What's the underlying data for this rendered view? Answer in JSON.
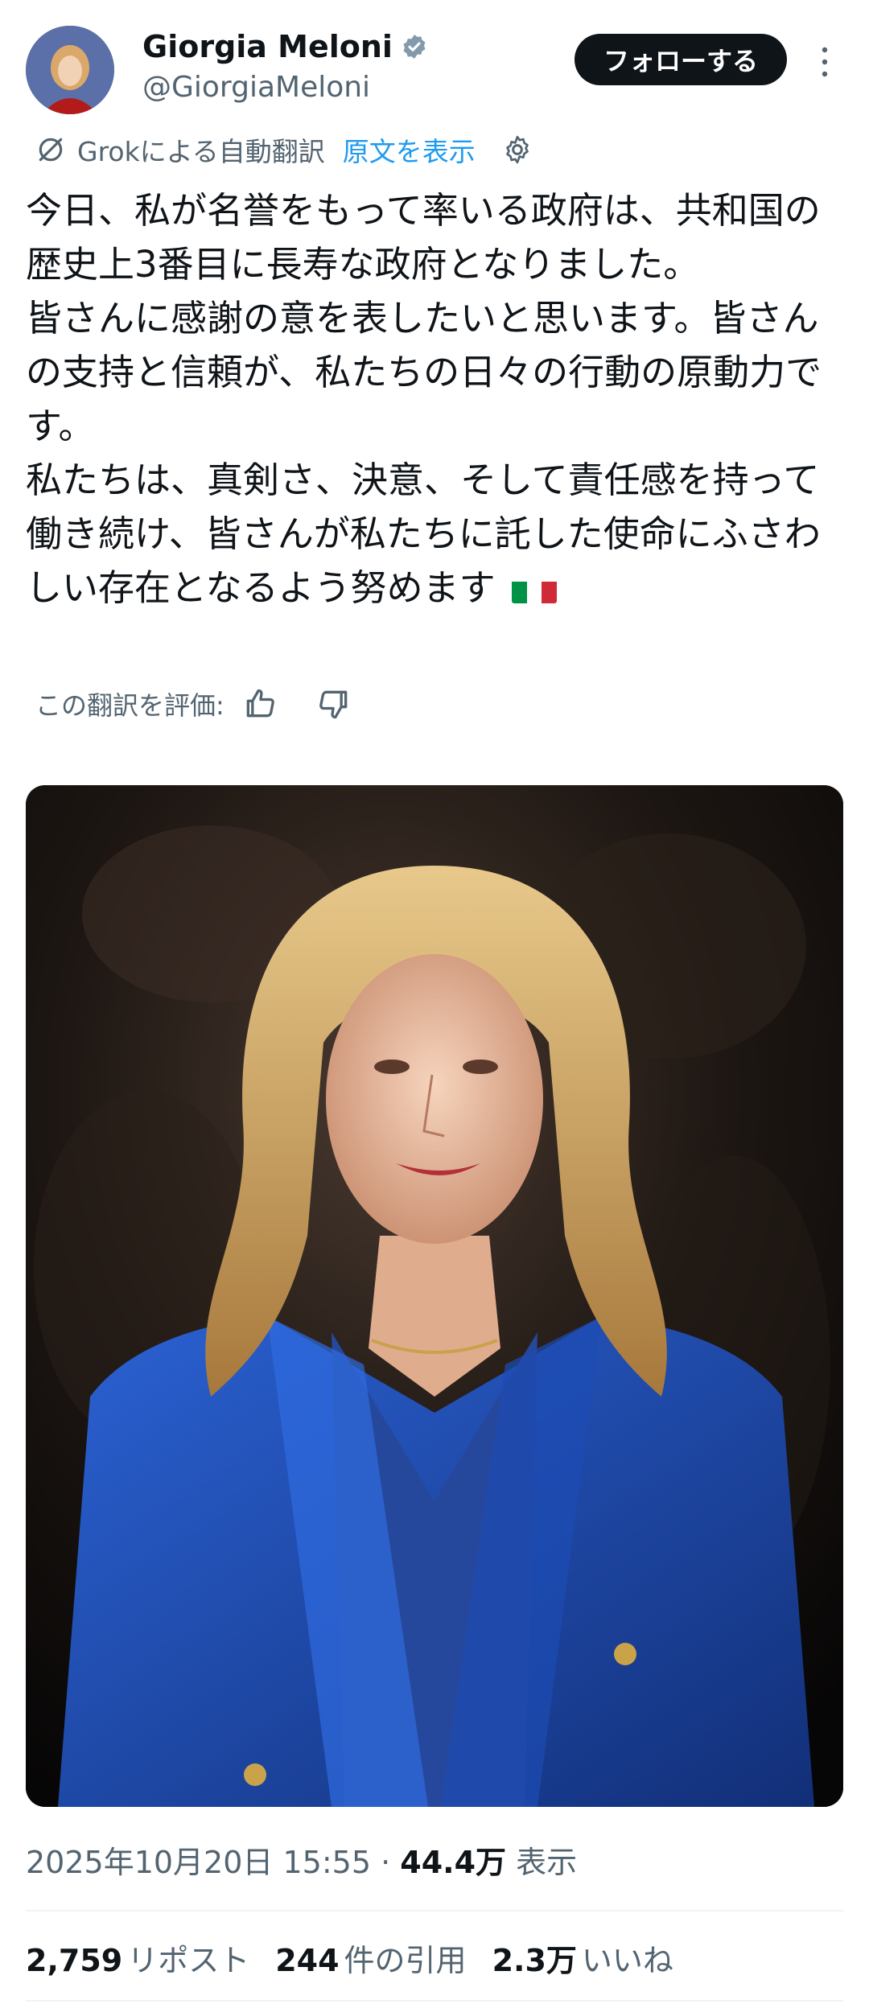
{
  "author": {
    "name": "Giorgia Meloni",
    "handle": "@GiorgiaMeloni",
    "verified": true
  },
  "actions": {
    "follow_label": "フォローする"
  },
  "translation": {
    "label": "Grokによる自動翻訳",
    "show_original": "原文を表示",
    "rate_label": "この翻訳を評価:"
  },
  "tweet": {
    "text": "今日、私が名誉をもって率いる政府は、共和国の歴史上3番目に長寿な政府となりました。\n皆さんに感謝の意を表したいと思います。皆さんの支持と信頼が、私たちの日々の行動の原動力です。\n私たちは、真剣さ、決意、そして責任感を持って働き続け、皆さんが私たちに託した使命にふさわしい存在となるよう努めます"
  },
  "meta": {
    "timestamp": "2025年10月20日 15:55",
    "separator": "·",
    "views_count": "44.4万",
    "views_label": "表示"
  },
  "stats": {
    "reposts_count": "2,759",
    "reposts_label": "リポスト",
    "quotes_count": "244",
    "quotes_label": "件の引用",
    "likes_count": "2.3万",
    "likes_label": "いいね"
  },
  "colors": {
    "text": "#0f1419",
    "secondary": "#536471",
    "link": "#1d9bf0",
    "verified_badge": "#829aab",
    "blazer": "#1f4fb5"
  }
}
